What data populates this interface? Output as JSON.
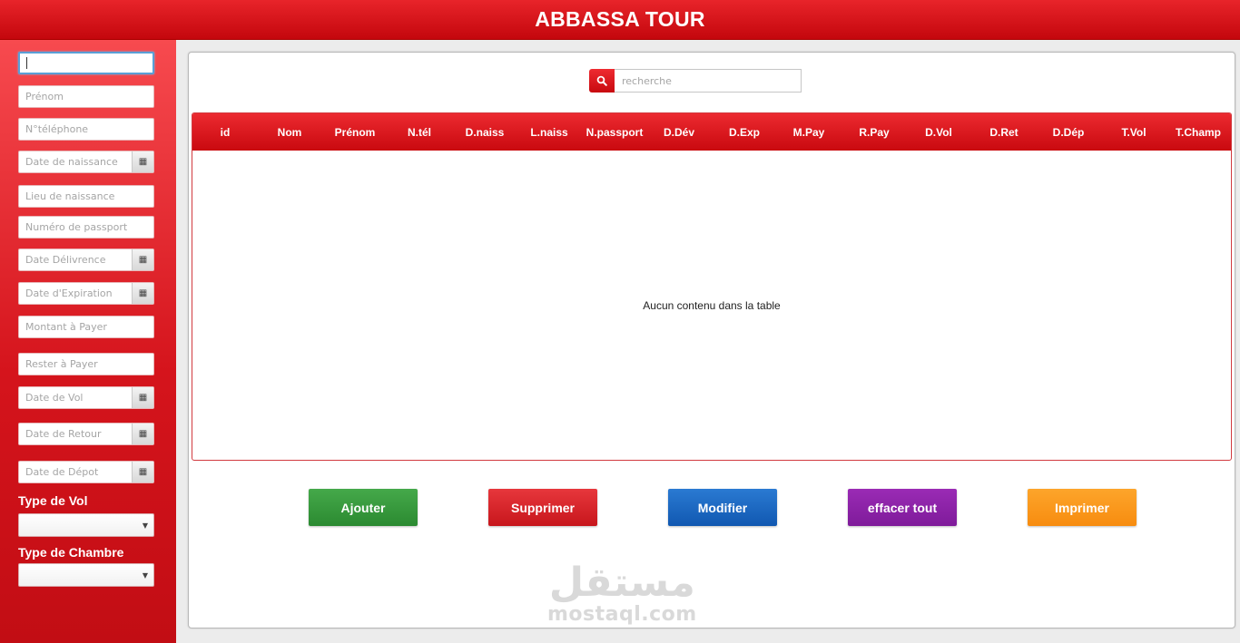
{
  "app": {
    "title": "ABBASSA TOUR"
  },
  "form": {
    "first_value": "",
    "prenom": "Prénom",
    "telephone": "N°téléphone",
    "date_naissance": "Date de naissance",
    "lieu_naissance": "Lieu de naissance",
    "passport": "Numéro de passport",
    "date_delivrence": "Date Délivrence",
    "date_expiration": "Date d'Expiration",
    "montant": "Montant à Payer",
    "rester": "Rester à Payer",
    "date_vol": "Date de Vol",
    "date_retour": "Date de Retour",
    "date_depot": "Date de Dépot",
    "type_vol_label": "Type de Vol",
    "type_vol_value": "",
    "type_chambre_label": "Type de Chambre",
    "type_chambre_value": ""
  },
  "search": {
    "placeholder": "recherche"
  },
  "table": {
    "columns": [
      "id",
      "Nom",
      "Prénom",
      "N.tél",
      "D.naiss",
      "L.naiss",
      "N.passport",
      "D.Dév",
      "D.Exp",
      "M.Pay",
      "R.Pay",
      "D.Vol",
      "D.Ret",
      "D.Dép",
      "T.Vol",
      "T.Champ"
    ],
    "empty_message": "Aucun contenu dans la table"
  },
  "actions": {
    "add": "Ajouter",
    "delete": "Supprimer",
    "edit": "Modifier",
    "clear": "effacer tout",
    "print": "Imprimer"
  },
  "watermark": {
    "arabic": "مستقل",
    "latin": "mostaql.com"
  },
  "colors": {
    "brand_red": "#d5141c",
    "add": "#2b8a31",
    "delete": "#c7161c",
    "edit": "#1158b1",
    "clear": "#7f1b9a",
    "print": "#f78c0f"
  },
  "icons": {
    "search": "search-icon",
    "calendar": "calendar-icon",
    "dropdown": "chevron-down-icon"
  }
}
